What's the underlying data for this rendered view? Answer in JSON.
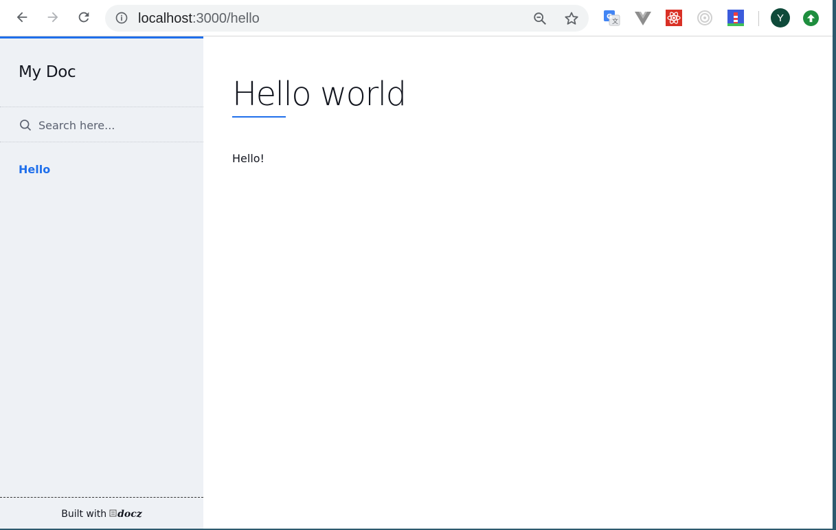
{
  "browser": {
    "url_host": "localhost",
    "url_rest": ":3000/hello",
    "profile_initial": "Y"
  },
  "sidebar": {
    "brand": "My Doc",
    "search_placeholder": "Search here...",
    "nav_items": [
      {
        "label": "Hello",
        "active": true
      }
    ],
    "footer_text": "Built with",
    "footer_logo": "docz"
  },
  "main": {
    "title": "Hello world",
    "body": "Hello!"
  },
  "colors": {
    "accent": "#1f6feb",
    "sidebar_bg": "#eef1f5"
  }
}
